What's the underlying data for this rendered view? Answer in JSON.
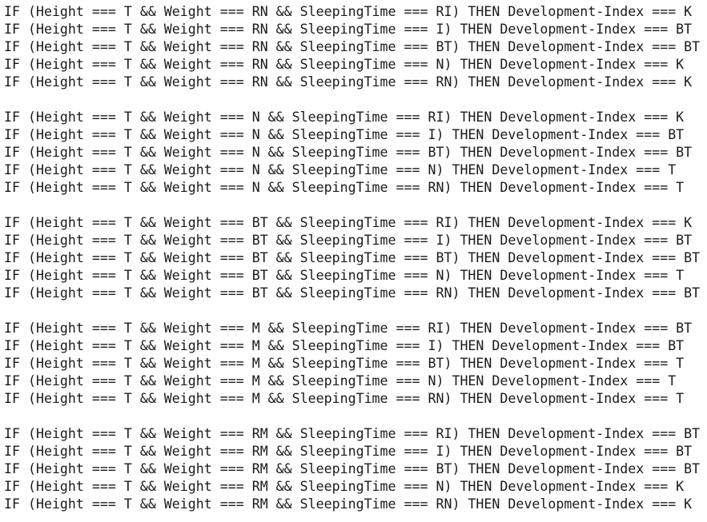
{
  "groups": [
    {
      "lines": [
        "IF (Height === T && Weight === RN && SleepingTime === RI) THEN Development-Index === K",
        "IF (Height === T && Weight === RN && SleepingTime === I) THEN Development-Index === BT",
        "IF (Height === T && Weight === RN && SleepingTime === BT) THEN Development-Index === BT",
        "IF (Height === T && Weight === RN && SleepingTime === N) THEN Development-Index === K",
        "IF (Height === T && Weight === RN && SleepingTime === RN) THEN Development-Index === K"
      ]
    },
    {
      "lines": [
        "IF (Height === T && Weight === N && SleepingTime === RI) THEN Development-Index === K",
        "IF (Height === T && Weight === N && SleepingTime === I) THEN Development-Index === BT",
        "IF (Height === T && Weight === N && SleepingTime === BT) THEN Development-Index === BT",
        "IF (Height === T && Weight === N && SleepingTime === N) THEN Development-Index === T",
        "IF (Height === T && Weight === N && SleepingTime === RN) THEN Development-Index === T"
      ]
    },
    {
      "lines": [
        "IF (Height === T && Weight === BT && SleepingTime === RI) THEN Development-Index === K",
        "IF (Height === T && Weight === BT && SleepingTime === I) THEN Development-Index === BT",
        "IF (Height === T && Weight === BT && SleepingTime === BT) THEN Development-Index === BT",
        "IF (Height === T && Weight === BT && SleepingTime === N) THEN Development-Index === T",
        "IF (Height === T && Weight === BT && SleepingTime === RN) THEN Development-Index === BT"
      ]
    },
    {
      "lines": [
        "IF (Height === T && Weight === M && SleepingTime === RI) THEN Development-Index === BT",
        "IF (Height === T && Weight === M && SleepingTime === I) THEN Development-Index === BT",
        "IF (Height === T && Weight === M && SleepingTime === BT) THEN Development-Index === T",
        "IF (Height === T && Weight === M && SleepingTime === N) THEN Development-Index === T",
        "IF (Height === T && Weight === M && SleepingTime === RN) THEN Development-Index === T"
      ]
    },
    {
      "lines": [
        "IF (Height === T && Weight === RM && SleepingTime === RI) THEN Development-Index === BT",
        "IF (Height === T && Weight === RM && SleepingTime === I) THEN Development-Index === BT",
        "IF (Height === T && Weight === RM && SleepingTime === BT) THEN Development-Index === BT",
        "IF (Height === T && Weight === RM && SleepingTime === N) THEN Development-Index === K",
        "IF (Height === T && Weight === RM && SleepingTime === RN) THEN Development-Index === K"
      ]
    }
  ]
}
